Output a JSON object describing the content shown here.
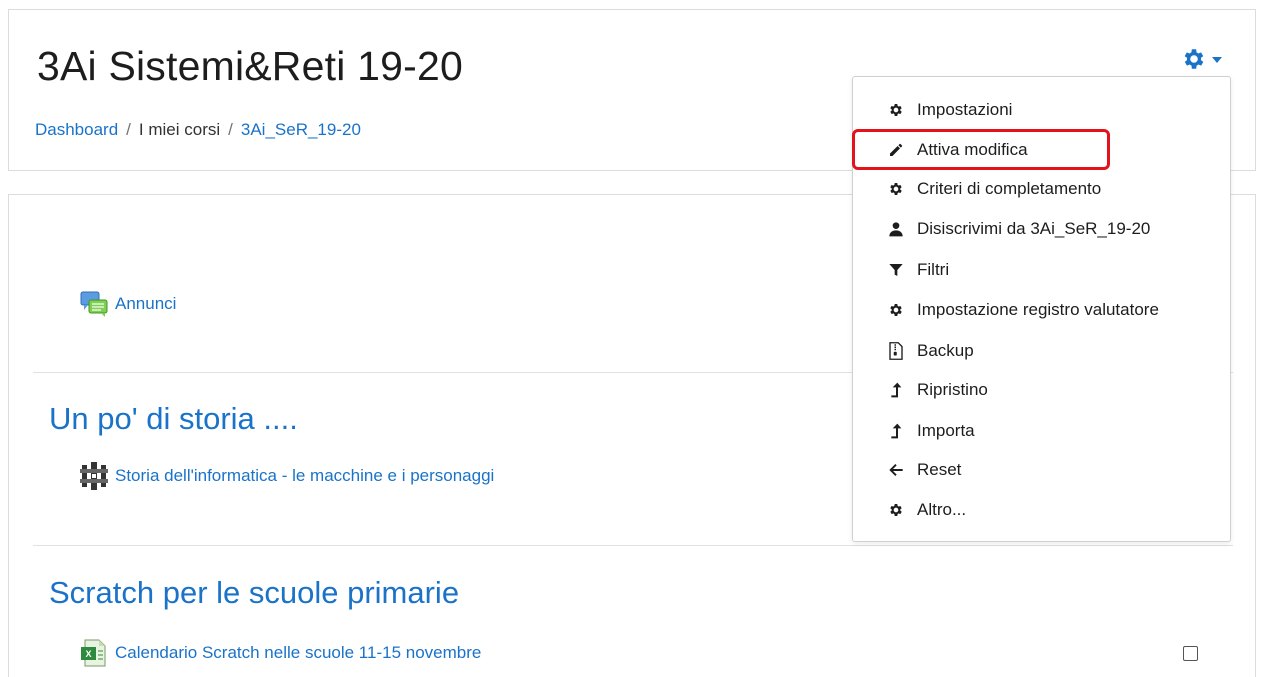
{
  "header": {
    "title": "3Ai Sistemi&Reti 19-20",
    "breadcrumb": {
      "dashboard": "Dashboard",
      "separator": "/",
      "my_courses": "I miei corsi",
      "course": "3Ai_SeR_19-20"
    }
  },
  "gear_menu": {
    "items": [
      {
        "label": "Impostazioni",
        "icon": "gear-icon"
      },
      {
        "label": "Attiva modifica",
        "icon": "pencil-icon"
      },
      {
        "label": "Criteri di completamento",
        "icon": "gear-icon"
      },
      {
        "label": "Disiscrivimi da 3Ai_SeR_19-20",
        "icon": "user-icon"
      },
      {
        "label": "Filtri",
        "icon": "filter-icon"
      },
      {
        "label": "Impostazione registro valutatore",
        "icon": "gear-icon"
      },
      {
        "label": "Backup",
        "icon": "archive-file-icon"
      },
      {
        "label": "Ripristino",
        "icon": "upload-arrow-icon"
      },
      {
        "label": "Importa",
        "icon": "upload-arrow-icon"
      },
      {
        "label": "Reset",
        "icon": "arrow-left-icon"
      },
      {
        "label": "Altro...",
        "icon": "gear-icon"
      }
    ],
    "highlighted_index": 1
  },
  "content": {
    "announcements": {
      "label": "Annunci",
      "icon": "forum-icon"
    },
    "sections": [
      {
        "title": "Un po' di storia ....",
        "activities": [
          {
            "label": "Storia dell'informatica - le macchine e i personaggi",
            "icon": "scorm-package-icon"
          }
        ]
      },
      {
        "title": "Scratch per le scuole primarie",
        "activities": [
          {
            "label": "Calendario Scratch nelle scuole 11-15 novembre",
            "icon": "spreadsheet-file-icon"
          }
        ]
      }
    ]
  },
  "colors": {
    "link": "#1a73c9",
    "highlight": "#e3131b",
    "text": "#1d1d1d",
    "border": "#dcdcdc"
  }
}
